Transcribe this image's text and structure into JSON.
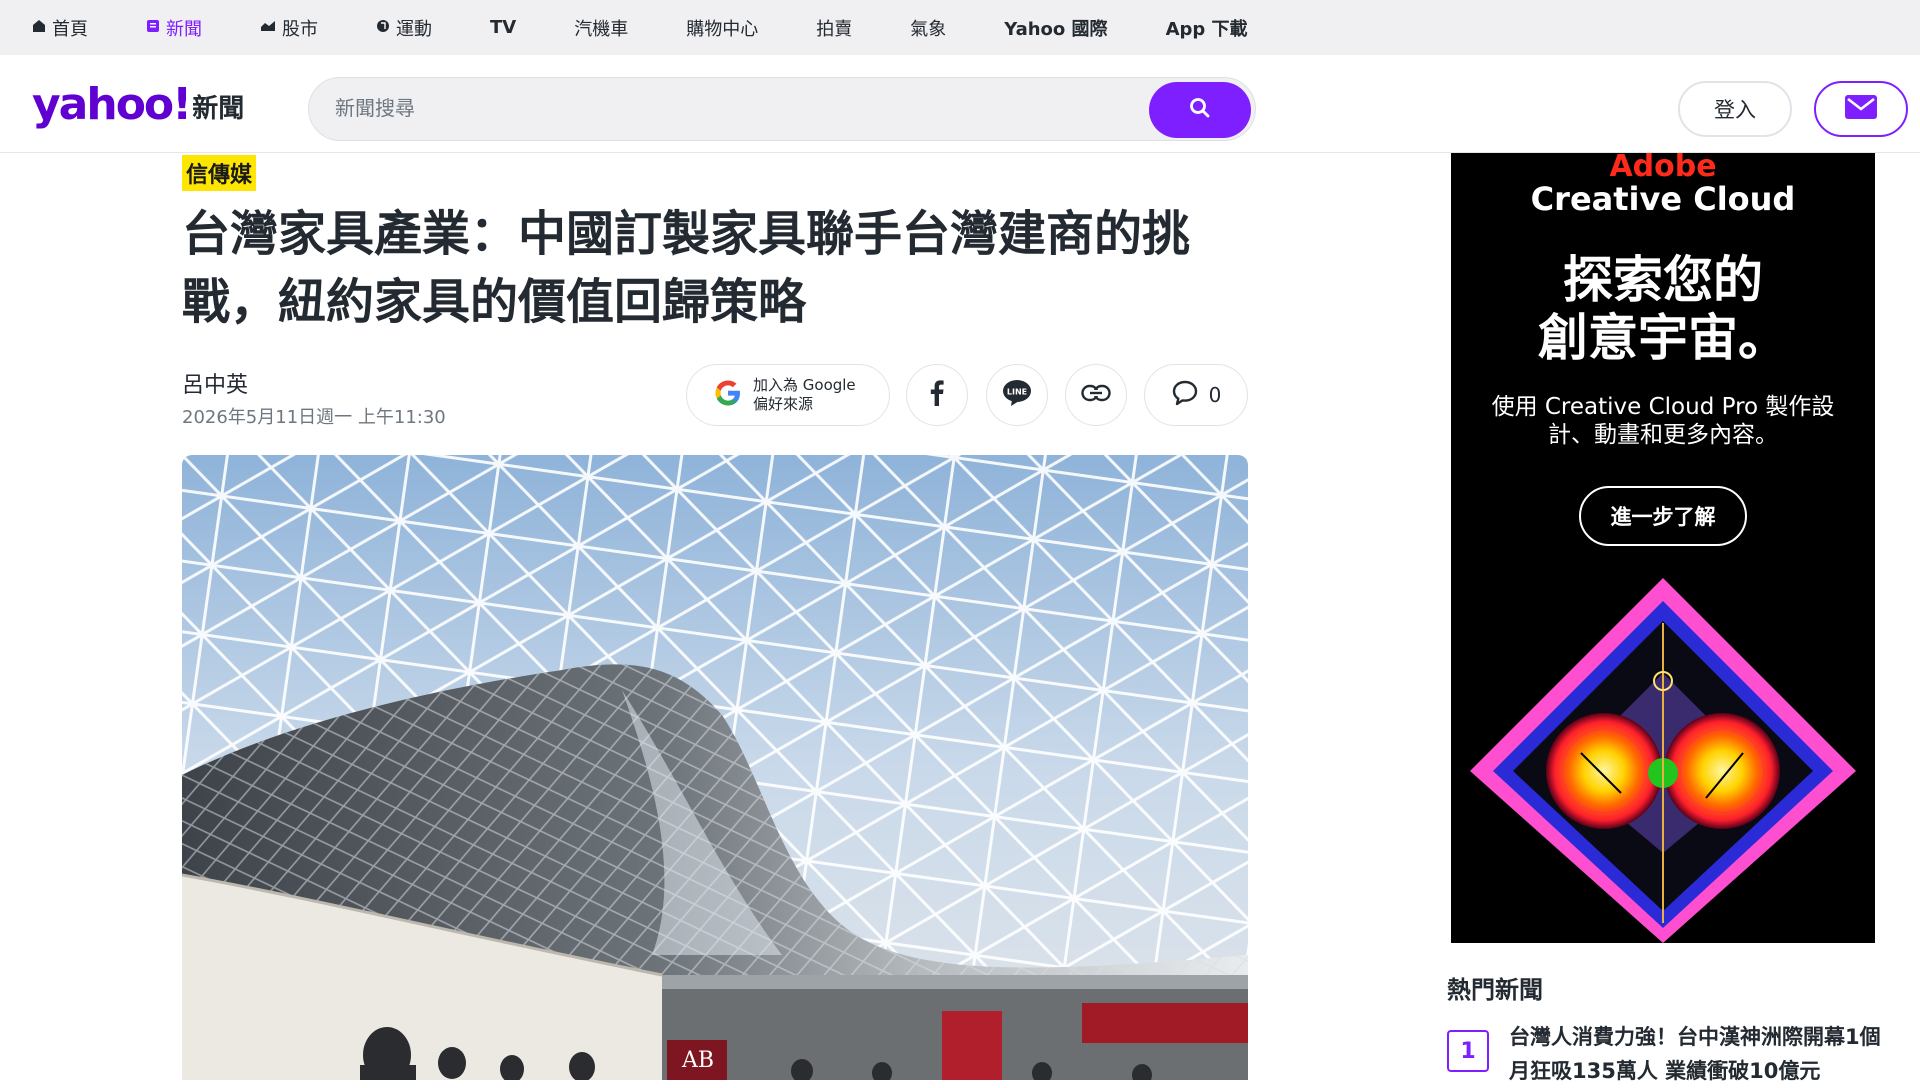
{
  "topnav": {
    "items": [
      {
        "label": "首頁",
        "icon": "home-icon"
      },
      {
        "label": "新聞",
        "icon": "news-icon",
        "active": true
      },
      {
        "label": "股市",
        "icon": "stock-icon"
      },
      {
        "label": "運動",
        "icon": "sports-icon"
      },
      {
        "label": "TV"
      },
      {
        "label": "汽機車"
      },
      {
        "label": "購物中心"
      },
      {
        "label": "拍賣"
      },
      {
        "label": "氣象"
      },
      {
        "label": "Yahoo 國際"
      },
      {
        "label": "App 下載"
      }
    ]
  },
  "header": {
    "logo_text": "yahoo!",
    "logo_sub": "新聞",
    "search_placeholder": "新聞搜尋",
    "login_label": "登入"
  },
  "article": {
    "source": "信傳媒",
    "title": "台灣家具產業：中國訂製家具聯手台灣建商的挑戰，紐約家具的價值回歸策略",
    "author": "呂中英",
    "date": "2026年5月11日週一 上午11:30",
    "google_pref_line1": "加入為 Google",
    "google_pref_line2": "偏好來源",
    "comment_count": "0",
    "hero_sign_text": "AB"
  },
  "ad": {
    "brand": "Adobe",
    "product": "Creative Cloud",
    "headline_line1": "探索您的",
    "headline_line2": "創意宇宙。",
    "body": "使用 Creative Cloud Pro 製作設計、動畫和更多內容。",
    "cta": "進一步了解"
  },
  "trending": {
    "title": "熱門新聞",
    "items": [
      {
        "rank": "1",
        "text": "台灣人消費力強！台中漢神洲際開幕1個月狂吸135萬人 業績衝破10億元"
      }
    ]
  },
  "colors": {
    "accent": "#7e1fff",
    "brand_purple": "#6001d2",
    "tag_yellow": "#ffe600"
  }
}
